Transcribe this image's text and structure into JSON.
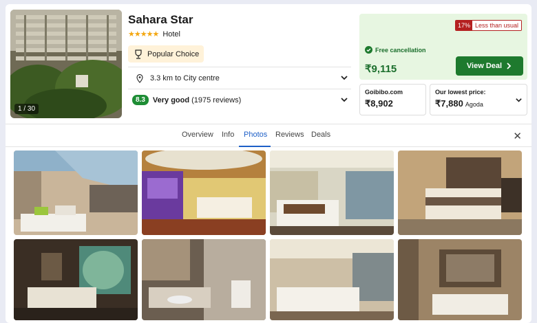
{
  "hotel": {
    "name": "Sahara Star",
    "stars": "★★★★★",
    "type": "Hotel",
    "photo_counter": "1 / 30",
    "popular_label": "Popular Choice",
    "distance": "3.3 km to City centre",
    "rating_score": "8.3",
    "rating_text": "Very good",
    "reviews": "(1975 reviews)"
  },
  "deal": {
    "discount_pct": "17%",
    "discount_label": "Less than usual",
    "free_cancel": "Free cancellation",
    "price": "₹9,115",
    "button": "View Deal"
  },
  "alt_prices": [
    {
      "label": "Goibibo.com",
      "price": "₹8,902",
      "site": ""
    },
    {
      "label": "Our lowest price:",
      "price": "₹7,880",
      "site": "Agoda"
    }
  ],
  "tabs": [
    "Overview",
    "Info",
    "Photos",
    "Reviews",
    "Deals"
  ],
  "active_tab": "Photos",
  "colors": {
    "accent": "#1d5fc7",
    "deal_green": "#1e7a2e",
    "badge_red": "#b42020",
    "star": "#f3a712"
  }
}
